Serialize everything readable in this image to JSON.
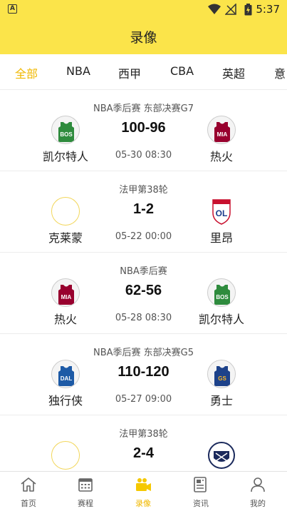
{
  "status_bar": {
    "time": "5:37",
    "app_icon": "A"
  },
  "header": {
    "title": "录像"
  },
  "tabs": [
    {
      "label": "全部",
      "active": true
    },
    {
      "label": "NBA",
      "active": false
    },
    {
      "label": "西甲",
      "active": false
    },
    {
      "label": "CBA",
      "active": false
    },
    {
      "label": "英超",
      "active": false
    },
    {
      "label": "意甲",
      "active": false
    }
  ],
  "matches": [
    {
      "league": "NBA季后赛 东部决赛G7",
      "score": "100-96",
      "time": "05-30 08:30",
      "home": {
        "name": "凯尔特人",
        "abbr": "BOS",
        "logo": "celtics-logo-icon"
      },
      "away": {
        "name": "热火",
        "abbr": "MIA",
        "logo": "heat-logo-icon"
      }
    },
    {
      "league": "法甲第38轮",
      "score": "1-2",
      "time": "05-22 00:00",
      "home": {
        "name": "克莱蒙",
        "abbr": "",
        "logo": "empty-logo-icon"
      },
      "away": {
        "name": "里昂",
        "abbr": "OL",
        "logo": "lyon-logo-icon"
      }
    },
    {
      "league": "NBA季后赛",
      "score": "62-56",
      "time": "05-28 08:30",
      "home": {
        "name": "热火",
        "abbr": "MIA",
        "logo": "heat-logo-icon"
      },
      "away": {
        "name": "凯尔特人",
        "abbr": "BOS",
        "logo": "celtics-logo-icon"
      }
    },
    {
      "league": "NBA季后赛 东部决赛G5",
      "score": "110-120",
      "time": "05-27 09:00",
      "home": {
        "name": "独行侠",
        "abbr": "DAL",
        "logo": "mavericks-logo-icon"
      },
      "away": {
        "name": "勇士",
        "abbr": "GS",
        "logo": "warriors-logo-icon"
      }
    },
    {
      "league": "法甲第38轮",
      "score": "2-4",
      "time": "",
      "home": {
        "name": "",
        "abbr": "",
        "logo": "empty-logo-icon"
      },
      "away": {
        "name": "",
        "abbr": "",
        "logo": "bordeaux-logo-icon"
      }
    }
  ],
  "bottom_nav": [
    {
      "label": "首页",
      "icon": "home-icon",
      "active": false
    },
    {
      "label": "赛程",
      "icon": "calendar-icon",
      "active": false
    },
    {
      "label": "录像",
      "icon": "video-icon",
      "active": true
    },
    {
      "label": "资讯",
      "icon": "news-icon",
      "active": false
    },
    {
      "label": "我的",
      "icon": "user-icon",
      "active": false
    }
  ],
  "colors": {
    "accent": "#fbe44a",
    "active_text": "#f0b800",
    "celtics": "#2e8b3d",
    "heat": "#98002e",
    "mavericks": "#1d5aa6",
    "warriors": "#1d428a"
  }
}
